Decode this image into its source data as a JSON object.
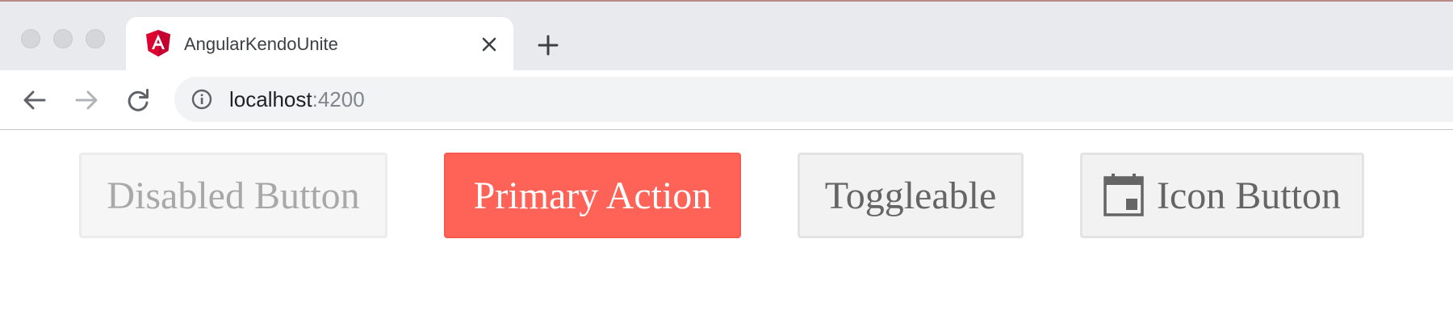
{
  "browser": {
    "tab": {
      "title": "AngularKendoUnite",
      "favicon": "angular-icon",
      "favicon_color": "#dd0031"
    },
    "new_tab_icon": "plus-icon",
    "toolbar": {
      "back_icon": "arrow-left-icon",
      "forward_icon": "arrow-right-icon",
      "reload_icon": "reload-icon",
      "address": {
        "info_icon": "info-icon",
        "host": "localhost",
        "port": ":4200"
      }
    }
  },
  "page": {
    "buttons": {
      "disabled": {
        "label": "Disabled Button",
        "state": "disabled"
      },
      "primary": {
        "label": "Primary Action",
        "color": "#ff6358"
      },
      "toggle": {
        "label": "Toggleable"
      },
      "icon": {
        "label": "Icon Button",
        "icon": "calendar-icon"
      }
    }
  }
}
